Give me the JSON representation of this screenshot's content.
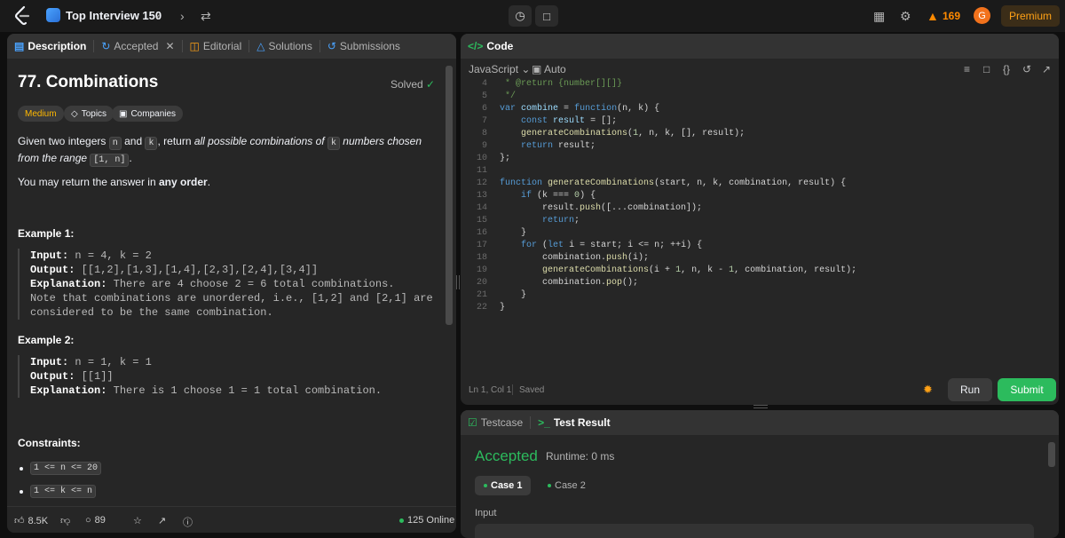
{
  "topbar": {
    "list_title": "Top Interview 150",
    "streak": "169",
    "avatar_letter": "G",
    "premium": "Premium"
  },
  "left": {
    "tabs": [
      "Description",
      "Accepted",
      "Editorial",
      "Solutions",
      "Submissions"
    ],
    "problem_title": "77. Combinations",
    "solved": "Solved",
    "tags": [
      "Medium",
      "Topics",
      "Companies"
    ],
    "desc_1": "Given two integers",
    "desc_n": "n",
    "desc_2": "and",
    "desc_k": "k",
    "desc_3": ", return",
    "desc_4": "all possible combinations of",
    "desc_5": "numbers chosen from the range",
    "desc_range": "[1, n]",
    "desc_6": ".",
    "para2_a": "You may return the answer in",
    "para2_b": "any order",
    "para2_c": ".",
    "ex1_title": "Example 1:",
    "ex1": {
      "input_label": "Input:",
      "input": " n = 4, k = 2",
      "output_label": "Output:",
      "output": " [[1,2],[1,3],[1,4],[2,3],[2,4],[3,4]]",
      "expl_label": "Explanation:",
      "expl_1": " There are 4 choose 2 = 6 total combinations.",
      "expl_2": "Note that combinations are unordered, i.e., [1,2] and [2,1] are",
      "expl_3": "considered to be the same combination."
    },
    "ex2_title": "Example 2:",
    "ex2": {
      "input_label": "Input:",
      "input": " n = 1, k = 1",
      "output_label": "Output:",
      "output": " [[1]]",
      "expl_label": "Explanation:",
      "expl_1": " There is 1 choose 1 = 1 total combination."
    },
    "constraints_title": "Constraints:",
    "constraints": [
      "1 <= n <= 20",
      "1 <= k <= n"
    ],
    "footer": {
      "likes": "8.5K",
      "comments": "89",
      "online": "125 Online"
    }
  },
  "code": {
    "tab": "Code",
    "language": "JavaScript",
    "mode": "Auto",
    "cursor": "Ln 1, Col 1",
    "saved": "Saved",
    "run": "Run",
    "submit": "Submit"
  },
  "result": {
    "tabs": [
      "Testcase",
      "Test Result"
    ],
    "status": "Accepted",
    "runtime": "Runtime: 0 ms",
    "cases": [
      "Case 1",
      "Case 2"
    ],
    "input_label": "Input"
  }
}
